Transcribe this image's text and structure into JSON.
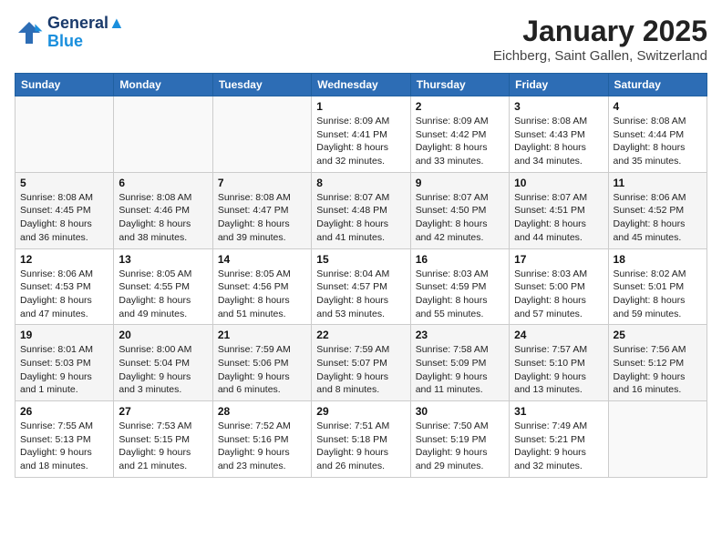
{
  "header": {
    "logo_line1": "General",
    "logo_line2": "Blue",
    "month": "January 2025",
    "location": "Eichberg, Saint Gallen, Switzerland"
  },
  "weekdays": [
    "Sunday",
    "Monday",
    "Tuesday",
    "Wednesday",
    "Thursday",
    "Friday",
    "Saturday"
  ],
  "weeks": [
    [
      {
        "day": "",
        "info": ""
      },
      {
        "day": "",
        "info": ""
      },
      {
        "day": "",
        "info": ""
      },
      {
        "day": "1",
        "info": "Sunrise: 8:09 AM\nSunset: 4:41 PM\nDaylight: 8 hours and 32 minutes."
      },
      {
        "day": "2",
        "info": "Sunrise: 8:09 AM\nSunset: 4:42 PM\nDaylight: 8 hours and 33 minutes."
      },
      {
        "day": "3",
        "info": "Sunrise: 8:08 AM\nSunset: 4:43 PM\nDaylight: 8 hours and 34 minutes."
      },
      {
        "day": "4",
        "info": "Sunrise: 8:08 AM\nSunset: 4:44 PM\nDaylight: 8 hours and 35 minutes."
      }
    ],
    [
      {
        "day": "5",
        "info": "Sunrise: 8:08 AM\nSunset: 4:45 PM\nDaylight: 8 hours and 36 minutes."
      },
      {
        "day": "6",
        "info": "Sunrise: 8:08 AM\nSunset: 4:46 PM\nDaylight: 8 hours and 38 minutes."
      },
      {
        "day": "7",
        "info": "Sunrise: 8:08 AM\nSunset: 4:47 PM\nDaylight: 8 hours and 39 minutes."
      },
      {
        "day": "8",
        "info": "Sunrise: 8:07 AM\nSunset: 4:48 PM\nDaylight: 8 hours and 41 minutes."
      },
      {
        "day": "9",
        "info": "Sunrise: 8:07 AM\nSunset: 4:50 PM\nDaylight: 8 hours and 42 minutes."
      },
      {
        "day": "10",
        "info": "Sunrise: 8:07 AM\nSunset: 4:51 PM\nDaylight: 8 hours and 44 minutes."
      },
      {
        "day": "11",
        "info": "Sunrise: 8:06 AM\nSunset: 4:52 PM\nDaylight: 8 hours and 45 minutes."
      }
    ],
    [
      {
        "day": "12",
        "info": "Sunrise: 8:06 AM\nSunset: 4:53 PM\nDaylight: 8 hours and 47 minutes."
      },
      {
        "day": "13",
        "info": "Sunrise: 8:05 AM\nSunset: 4:55 PM\nDaylight: 8 hours and 49 minutes."
      },
      {
        "day": "14",
        "info": "Sunrise: 8:05 AM\nSunset: 4:56 PM\nDaylight: 8 hours and 51 minutes."
      },
      {
        "day": "15",
        "info": "Sunrise: 8:04 AM\nSunset: 4:57 PM\nDaylight: 8 hours and 53 minutes."
      },
      {
        "day": "16",
        "info": "Sunrise: 8:03 AM\nSunset: 4:59 PM\nDaylight: 8 hours and 55 minutes."
      },
      {
        "day": "17",
        "info": "Sunrise: 8:03 AM\nSunset: 5:00 PM\nDaylight: 8 hours and 57 minutes."
      },
      {
        "day": "18",
        "info": "Sunrise: 8:02 AM\nSunset: 5:01 PM\nDaylight: 8 hours and 59 minutes."
      }
    ],
    [
      {
        "day": "19",
        "info": "Sunrise: 8:01 AM\nSunset: 5:03 PM\nDaylight: 9 hours and 1 minute."
      },
      {
        "day": "20",
        "info": "Sunrise: 8:00 AM\nSunset: 5:04 PM\nDaylight: 9 hours and 3 minutes."
      },
      {
        "day": "21",
        "info": "Sunrise: 7:59 AM\nSunset: 5:06 PM\nDaylight: 9 hours and 6 minutes."
      },
      {
        "day": "22",
        "info": "Sunrise: 7:59 AM\nSunset: 5:07 PM\nDaylight: 9 hours and 8 minutes."
      },
      {
        "day": "23",
        "info": "Sunrise: 7:58 AM\nSunset: 5:09 PM\nDaylight: 9 hours and 11 minutes."
      },
      {
        "day": "24",
        "info": "Sunrise: 7:57 AM\nSunset: 5:10 PM\nDaylight: 9 hours and 13 minutes."
      },
      {
        "day": "25",
        "info": "Sunrise: 7:56 AM\nSunset: 5:12 PM\nDaylight: 9 hours and 16 minutes."
      }
    ],
    [
      {
        "day": "26",
        "info": "Sunrise: 7:55 AM\nSunset: 5:13 PM\nDaylight: 9 hours and 18 minutes."
      },
      {
        "day": "27",
        "info": "Sunrise: 7:53 AM\nSunset: 5:15 PM\nDaylight: 9 hours and 21 minutes."
      },
      {
        "day": "28",
        "info": "Sunrise: 7:52 AM\nSunset: 5:16 PM\nDaylight: 9 hours and 23 minutes."
      },
      {
        "day": "29",
        "info": "Sunrise: 7:51 AM\nSunset: 5:18 PM\nDaylight: 9 hours and 26 minutes."
      },
      {
        "day": "30",
        "info": "Sunrise: 7:50 AM\nSunset: 5:19 PM\nDaylight: 9 hours and 29 minutes."
      },
      {
        "day": "31",
        "info": "Sunrise: 7:49 AM\nSunset: 5:21 PM\nDaylight: 9 hours and 32 minutes."
      },
      {
        "day": "",
        "info": ""
      }
    ]
  ]
}
